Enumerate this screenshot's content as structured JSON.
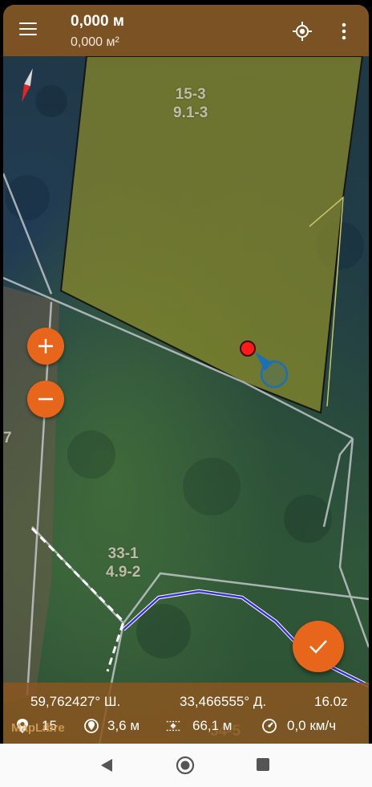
{
  "header": {
    "title": "0,000 м",
    "subtitle": "0,000 м²",
    "menu_icon": "hamburger-menu-icon",
    "locate_icon": "gps-locate-icon",
    "more_icon": "more-vertical-icon"
  },
  "map": {
    "parcels": [
      {
        "line1": "15-3",
        "line2": "9.1-3"
      },
      {
        "line1": "33-1",
        "line2": "4.9-2"
      },
      {
        "line1": "7"
      },
      {
        "line1": "34-5"
      }
    ],
    "attribution": "MapLibre",
    "colors": {
      "accent": "#e8661c",
      "bar": "#895620",
      "polygon_fill": "#8a8a2a",
      "track": "#3a2fd8",
      "marker": "#ff1a1a",
      "direction": "#1e6fb4"
    }
  },
  "controls": {
    "zoom_in_icon": "plus-icon",
    "zoom_out_icon": "minus-icon",
    "confirm_icon": "check-icon",
    "compass_icon": "compass-needle-icon"
  },
  "status": {
    "latitude": "59,762427° Ш.",
    "longitude": "33,466555° Д.",
    "zoom": "16.0z",
    "satellites": "15",
    "accuracy": "3,6 м",
    "altitude": "66,1 м",
    "speed": "0,0 км/ч"
  },
  "navbar": {
    "back_icon": "back-triangle-icon",
    "home_icon": "home-circle-icon",
    "recents_icon": "recents-square-icon"
  }
}
